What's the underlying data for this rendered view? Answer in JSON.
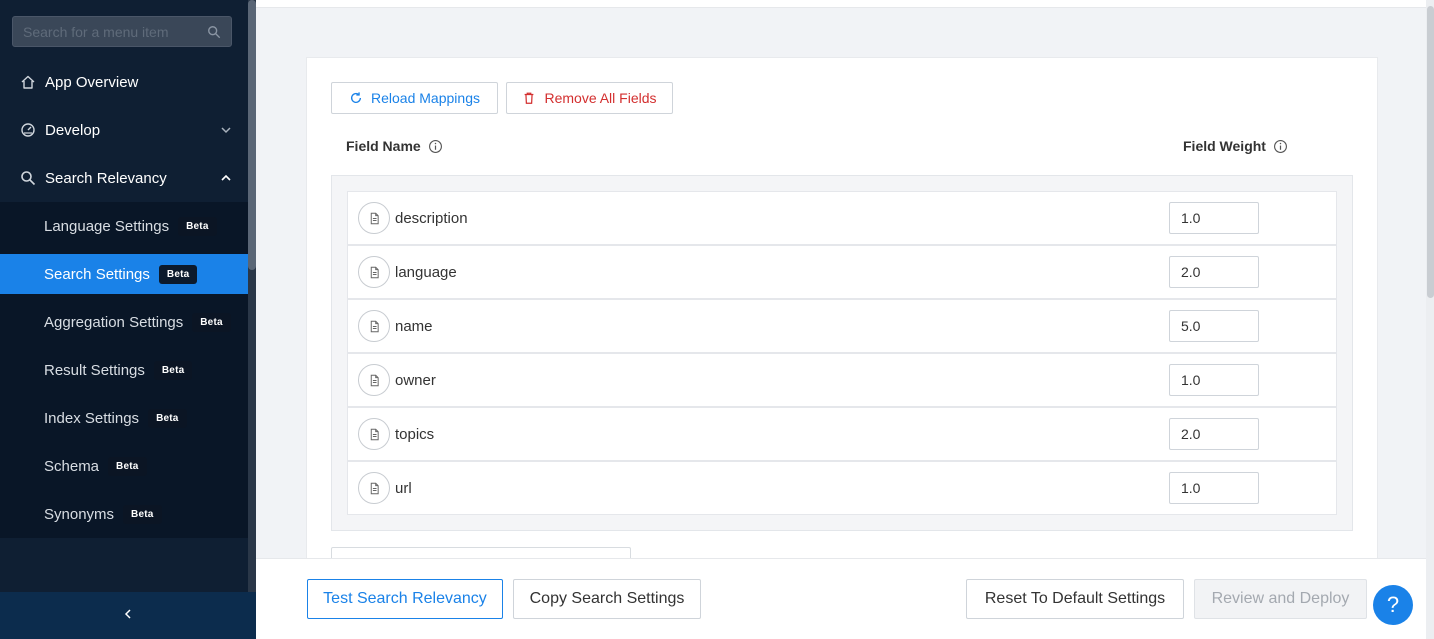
{
  "sidebar": {
    "search_placeholder": "Search for a menu item",
    "items": [
      {
        "label": "App Overview",
        "icon": "home-icon"
      },
      {
        "label": "Develop",
        "icon": "gauge-icon",
        "chevron": "chevron-down-icon"
      },
      {
        "label": "Search Relevancy",
        "icon": "search-icon",
        "chevron": "chevron-up-icon"
      }
    ],
    "submenu": [
      {
        "label": "Language Settings",
        "badge": "Beta"
      },
      {
        "label": "Search Settings",
        "badge": "Beta",
        "active": true
      },
      {
        "label": "Aggregation Settings",
        "badge": "Beta"
      },
      {
        "label": "Result Settings",
        "badge": "Beta"
      },
      {
        "label": "Index Settings",
        "badge": "Beta"
      },
      {
        "label": "Schema",
        "badge": "Beta"
      },
      {
        "label": "Synonyms",
        "badge": "Beta"
      }
    ],
    "collapse_glyph": "‹"
  },
  "toolbar": {
    "reload_label": "Reload Mappings",
    "remove_label": "Remove All Fields"
  },
  "table": {
    "col_name": "Field Name",
    "col_weight": "Field Weight",
    "rows": [
      {
        "name": "description",
        "weight": "1.0"
      },
      {
        "name": "language",
        "weight": "2.0"
      },
      {
        "name": "name",
        "weight": "5.0"
      },
      {
        "name": "owner",
        "weight": "1.0"
      },
      {
        "name": "topics",
        "weight": "2.0"
      },
      {
        "name": "url",
        "weight": "1.0"
      }
    ]
  },
  "footer": {
    "test_label": "Test Search Relevancy",
    "copy_label": "Copy Search Settings",
    "reset_label": "Reset To Default Settings",
    "deploy_label": "Review and Deploy",
    "help_glyph": "?"
  },
  "colors": {
    "sidebar_bg": "#0f1f33",
    "accent": "#1a82e8",
    "danger": "#d32f2f"
  }
}
